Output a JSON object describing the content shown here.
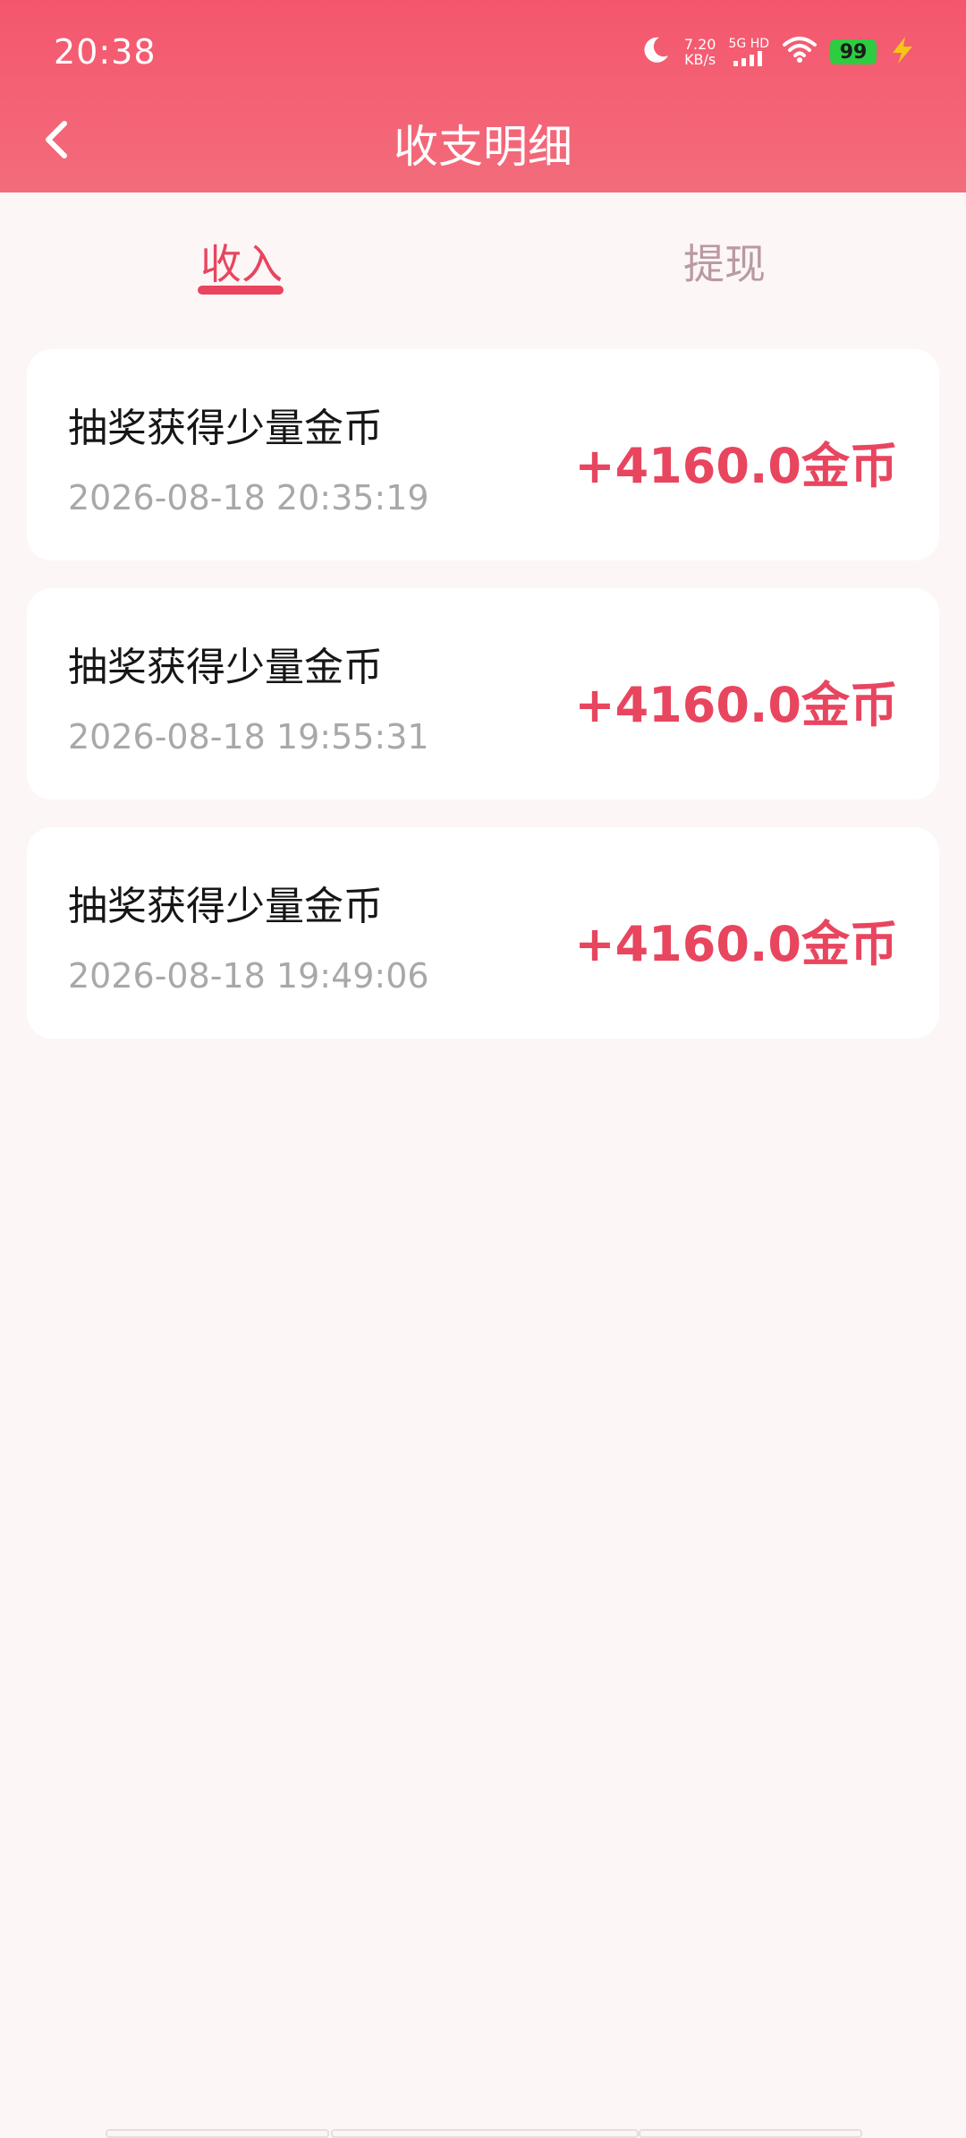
{
  "status_bar": {
    "time": "20:38",
    "speed_value": "7.20",
    "speed_unit": "KB/s",
    "network": "5G HD",
    "battery": "99"
  },
  "header": {
    "title": "收支明细"
  },
  "tabs": [
    {
      "label": "收入",
      "active": true
    },
    {
      "label": "提现",
      "active": false
    }
  ],
  "records": [
    {
      "title": "抽奖获得少量金币",
      "time": "2026-08-18 20:35:19",
      "amount": "+4160.0金币"
    },
    {
      "title": "抽奖获得少量金币",
      "time": "2026-08-18 19:55:31",
      "amount": "+4160.0金币"
    },
    {
      "title": "抽奖获得少量金币",
      "time": "2026-08-18 19:49:06",
      "amount": "+4160.0金币"
    }
  ],
  "colors": {
    "accent": "#e8455f",
    "header_top": "#f4566d",
    "header_bottom": "#f36c7c",
    "background": "#fdf6f6"
  }
}
